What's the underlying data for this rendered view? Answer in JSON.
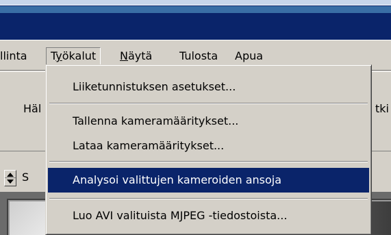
{
  "menubar": {
    "items": [
      {
        "label": "llinta",
        "underline_index": -1
      },
      {
        "label": "Työkalut",
        "underline_index": 1
      },
      {
        "label": "Näytä",
        "underline_index": 0
      },
      {
        "label": "Tulosta",
        "underline_index": -1
      },
      {
        "label": "Apua",
        "underline_index": -1
      }
    ],
    "active": "Työkalut"
  },
  "toolbar": {
    "left_button_label": "Häl",
    "right_button_label": "tki",
    "spinner_label": "S"
  },
  "dropdown": {
    "items": [
      {
        "label": "Liiketunnistuksen asetukset...",
        "highlighted": false
      },
      {
        "label": "Tallenna kameramääritykset...",
        "highlighted": false
      },
      {
        "label": "Lataa kameramääritykset...",
        "highlighted": false
      },
      {
        "label": "Analysoi valittujen kameroiden ansoja",
        "highlighted": true
      },
      {
        "label": "Luo AVI valituista MJPEG -tiedostoista...",
        "highlighted": false
      }
    ]
  },
  "colors": {
    "titlebar": "#0a246a",
    "menu_face": "#d4d0c8",
    "highlight": "#0a246a",
    "highlight_text": "#ffffff"
  }
}
